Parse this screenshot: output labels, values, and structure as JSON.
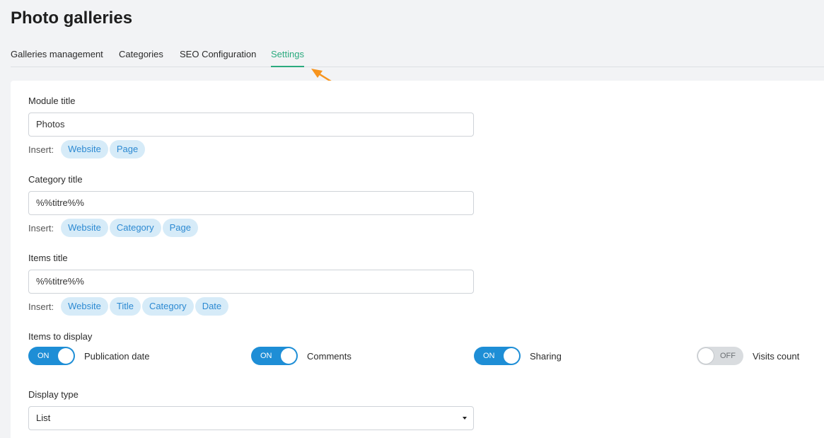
{
  "page": {
    "title": "Photo galleries"
  },
  "tabs": [
    {
      "label": "Galleries management",
      "active": false
    },
    {
      "label": "Categories",
      "active": false
    },
    {
      "label": "SEO Configuration",
      "active": false
    },
    {
      "label": "Settings",
      "active": true
    }
  ],
  "colors": {
    "accent_green": "#2aaa7e",
    "toggle_blue": "#1e8ed6",
    "chip_bg": "#d6ebf8",
    "chip_text": "#2d8ad2",
    "arrow_orange": "#f7941d"
  },
  "insert_label": "Insert:",
  "fields": {
    "module_title": {
      "label": "Module title",
      "value": "Photos",
      "chips": [
        "Website",
        "Page"
      ]
    },
    "category_title": {
      "label": "Category title",
      "value": "%%titre%%",
      "chips": [
        "Website",
        "Category",
        "Page"
      ]
    },
    "items_title": {
      "label": "Items title",
      "value": "%%titre%%",
      "chips": [
        "Website",
        "Title",
        "Category",
        "Date"
      ]
    }
  },
  "items_to_display": {
    "label": "Items to display",
    "toggles": [
      {
        "state": "ON",
        "label": "Publication date",
        "on": true
      },
      {
        "state": "ON",
        "label": "Comments",
        "on": true
      },
      {
        "state": "ON",
        "label": "Sharing",
        "on": true
      },
      {
        "state": "OFF",
        "label": "Visits count",
        "on": false
      }
    ]
  },
  "display_type": {
    "label": "Display type",
    "value": "List",
    "icon": "caret-down-icon"
  }
}
